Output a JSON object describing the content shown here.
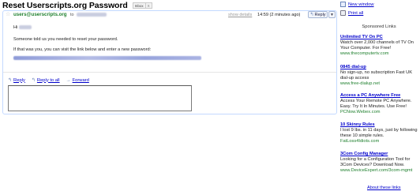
{
  "subject": "Reset Userscripts.org Password",
  "label": {
    "name": "Inbox",
    "remove": "X"
  },
  "message": {
    "from": "users@userscripts.org",
    "to_prefix": "to",
    "show_details": "show details",
    "time": "14:59 (2 minutes ago)",
    "reply_label": "Reply",
    "greeting": "Hi",
    "line1": "Someone told us you needed to reset your password.",
    "line2": "If that was you, you can visit the link below and enter a new password:"
  },
  "actions": {
    "reply": "Reply",
    "reply_all": "Reply to all",
    "forward": "Forward"
  },
  "sidebar": {
    "new_window": "New window",
    "print_all": "Print all",
    "sponsored_heading": "Sponsored Links",
    "ads": [
      {
        "title": "Unlimited TV On PC",
        "desc": "Watch over 2,000 channels of TV On Your Computer. For Free!",
        "url": "www.thecomputertv.com"
      },
      {
        "title": "0845 dial-up",
        "desc": "No sign-up, no subscription Fast UK dial-up access",
        "url": "www.free-dialup.net"
      },
      {
        "title": "Access a PC Anywhere Free",
        "desc": "Access Your Remote PC Anywhere. Easy. Try It In Minutes. Use Free!",
        "url": "PCNow.Webex.com"
      },
      {
        "title": "10 Skinny Rules",
        "desc": "I lost 9 lbs. in 11 days, just by following these 10 simple rules.",
        "url": "FatLoss4Idiots.com"
      },
      {
        "title": "3Com Config Manager",
        "desc": "Looking for a Configuration Tool for 3Com Devices? Download Now.",
        "url": "www.DeviceExpert.com/3com-mgmt"
      }
    ],
    "about": "About these links"
  },
  "colors": {
    "sender": "#20802f",
    "link": "#0000cc",
    "card_border": "#c3d9ff"
  }
}
